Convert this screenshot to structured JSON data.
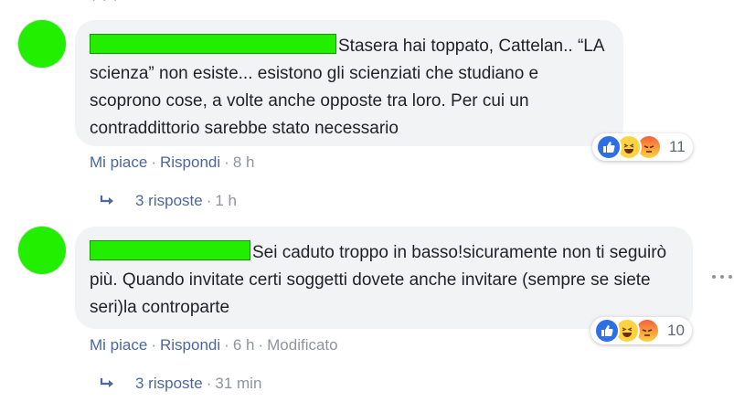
{
  "top_remnant": "·   ·   ·",
  "comments": [
    {
      "text": "Stasera hai toppato, Cattelan.. “LA scienza” non esiste... esistono gli scienziati che studiano e scoprono cose, a volte anche opposte tra loro. Per cui un contraddittorio sarebbe stato necessario",
      "reaction_count": "11",
      "actions": {
        "like": "Mi piace",
        "reply": "Rispondi",
        "time": "8 h"
      },
      "replies": {
        "label": "3 risposte",
        "time": "1 h"
      }
    },
    {
      "text": "Sei caduto troppo in basso!sicuramente non ti seguirò più. Quando invitate certi soggetti dovete anche invitare (sempre se siete seri)la controparte",
      "reaction_count": "10",
      "actions": {
        "like": "Mi piace",
        "reply": "Rispondi",
        "time": "6 h",
        "edited": "Modificato"
      },
      "replies": {
        "label": "3 risposte",
        "time": "31 min"
      }
    }
  ],
  "separator": "·",
  "icons": {
    "reactions": [
      "like-icon",
      "haha-icon",
      "angry-icon"
    ],
    "reply_arrow": "reply-arrow-icon",
    "more": "more-options-icon"
  },
  "colors": {
    "link": "#4b67a1",
    "meta": "#90949c",
    "bubble": "#f2f3f5",
    "redaction": "#22ee00",
    "like": "#2f6fe4"
  }
}
